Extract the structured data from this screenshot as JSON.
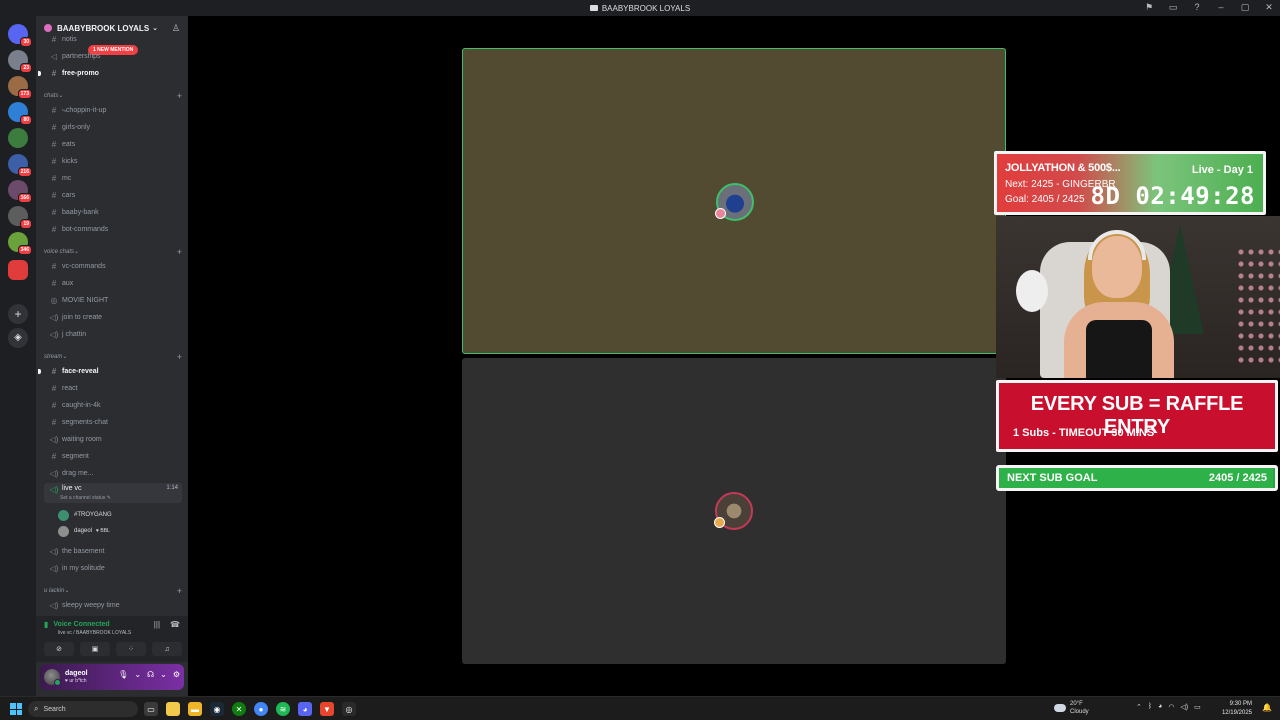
{
  "window": {
    "title": "BAABYBROOK LOYALS"
  },
  "rail": {
    "servers": [
      {
        "name": "direct-messages",
        "badge": "30",
        "color": "#5865f2"
      },
      {
        "name": "server-1",
        "badge": "23",
        "color": "#7a7f8c"
      },
      {
        "name": "server-2",
        "badge": "173",
        "color": "#9a6b45"
      },
      {
        "name": "server-3",
        "badge": "80",
        "color": "#2f7fd6"
      },
      {
        "name": "server-4",
        "badge": "",
        "color": "#3c7d3f"
      },
      {
        "name": "server-5",
        "badge": "216",
        "color": "#3d5fa8"
      },
      {
        "name": "server-6",
        "badge": "166",
        "color": "#6c4a6a"
      },
      {
        "name": "server-7",
        "badge": "19",
        "color": "#5d5d5d"
      },
      {
        "name": "server-8",
        "badge": "346",
        "color": "#6aa33b"
      },
      {
        "name": "server-9",
        "badge": "",
        "color": "#e03c3c"
      }
    ]
  },
  "sidebar": {
    "guild_name": "BAABYBROOK LOYALS",
    "mention_pill": "1 NEW MENTION",
    "top_channels": [
      {
        "label": "notis",
        "icon": "#"
      },
      {
        "label": "partnerships",
        "icon": "📢"
      },
      {
        "label": "free-promo",
        "icon": "#"
      }
    ],
    "cat_chats": "chats",
    "chats": [
      {
        "label": "⤷choppin-it-up",
        "icon": "#"
      },
      {
        "label": "girls-only",
        "icon": "#"
      },
      {
        "label": "eats",
        "icon": "#"
      },
      {
        "label": "kicks",
        "icon": "#"
      },
      {
        "label": "mc",
        "icon": "#"
      },
      {
        "label": "cars",
        "icon": "#"
      },
      {
        "label": "baaby-bank",
        "icon": "#"
      },
      {
        "label": "bot-commands",
        "icon": "#"
      }
    ],
    "cat_voice": "voice chats",
    "voice": [
      {
        "label": "vc-commands",
        "icon": "#"
      },
      {
        "label": "aux",
        "icon": "#"
      },
      {
        "label": "MOVIE NIGHT",
        "icon": "◎"
      },
      {
        "label": "join to create",
        "icon": "🔊"
      },
      {
        "label": "j chattin",
        "icon": "🔊"
      }
    ],
    "cat_stream": "stream",
    "stream": [
      {
        "label": "face-reveal",
        "icon": "#"
      },
      {
        "label": "react",
        "icon": "#"
      },
      {
        "label": "caught-in-4k",
        "icon": "#"
      },
      {
        "label": "segments-chat",
        "icon": "#"
      },
      {
        "label": "waiting room",
        "icon": "🔊"
      },
      {
        "label": "segment",
        "icon": "#"
      },
      {
        "label": "drag me...",
        "icon": "🔊"
      }
    ],
    "live_vc": {
      "label": "live vc",
      "time": "1:14",
      "status": "Set a channel status ✎"
    },
    "vc_users": [
      {
        "name": "#TROYGANG",
        "tag": ""
      },
      {
        "name": "dageol",
        "tag": "♥ BBL"
      }
    ],
    "after_live": [
      {
        "label": "the basement",
        "icon": "🔊"
      },
      {
        "label": "in my solitude",
        "icon": "🔊"
      }
    ],
    "cat_lackin": "u lackin",
    "lackin": [
      {
        "label": "sleepy weepy time",
        "icon": "🔊"
      }
    ]
  },
  "voice_panel": {
    "status": "Voice Connected",
    "location": "live vc / BAABYBROOK LOYALS"
  },
  "user_panel": {
    "name": "dageol",
    "status": "♥ ur b*tch"
  },
  "overlay": {
    "timer_line1": "JOLLYATHON & 500$...",
    "timer_line2": "Next: 2425 - GINGERBR",
    "timer_line3": "Goal: 2405 / 2425",
    "live_label": "Live - Day 1",
    "clock": "8D 02:49:28",
    "raffle_title": "EVERY SUB = RAFFLE ENTRY",
    "raffle_sub": "1 Subs - TIMEOUT 30 MINS",
    "goal_label": "NEXT SUB GOAL",
    "goal_value": "2405 / 2425",
    "goal_progress": 0.992
  },
  "taskbar": {
    "search_placeholder": "Search",
    "weather_temp": "20°F",
    "weather_desc": "Cloudy",
    "time": "9:30 PM",
    "date": "12/19/2025"
  }
}
